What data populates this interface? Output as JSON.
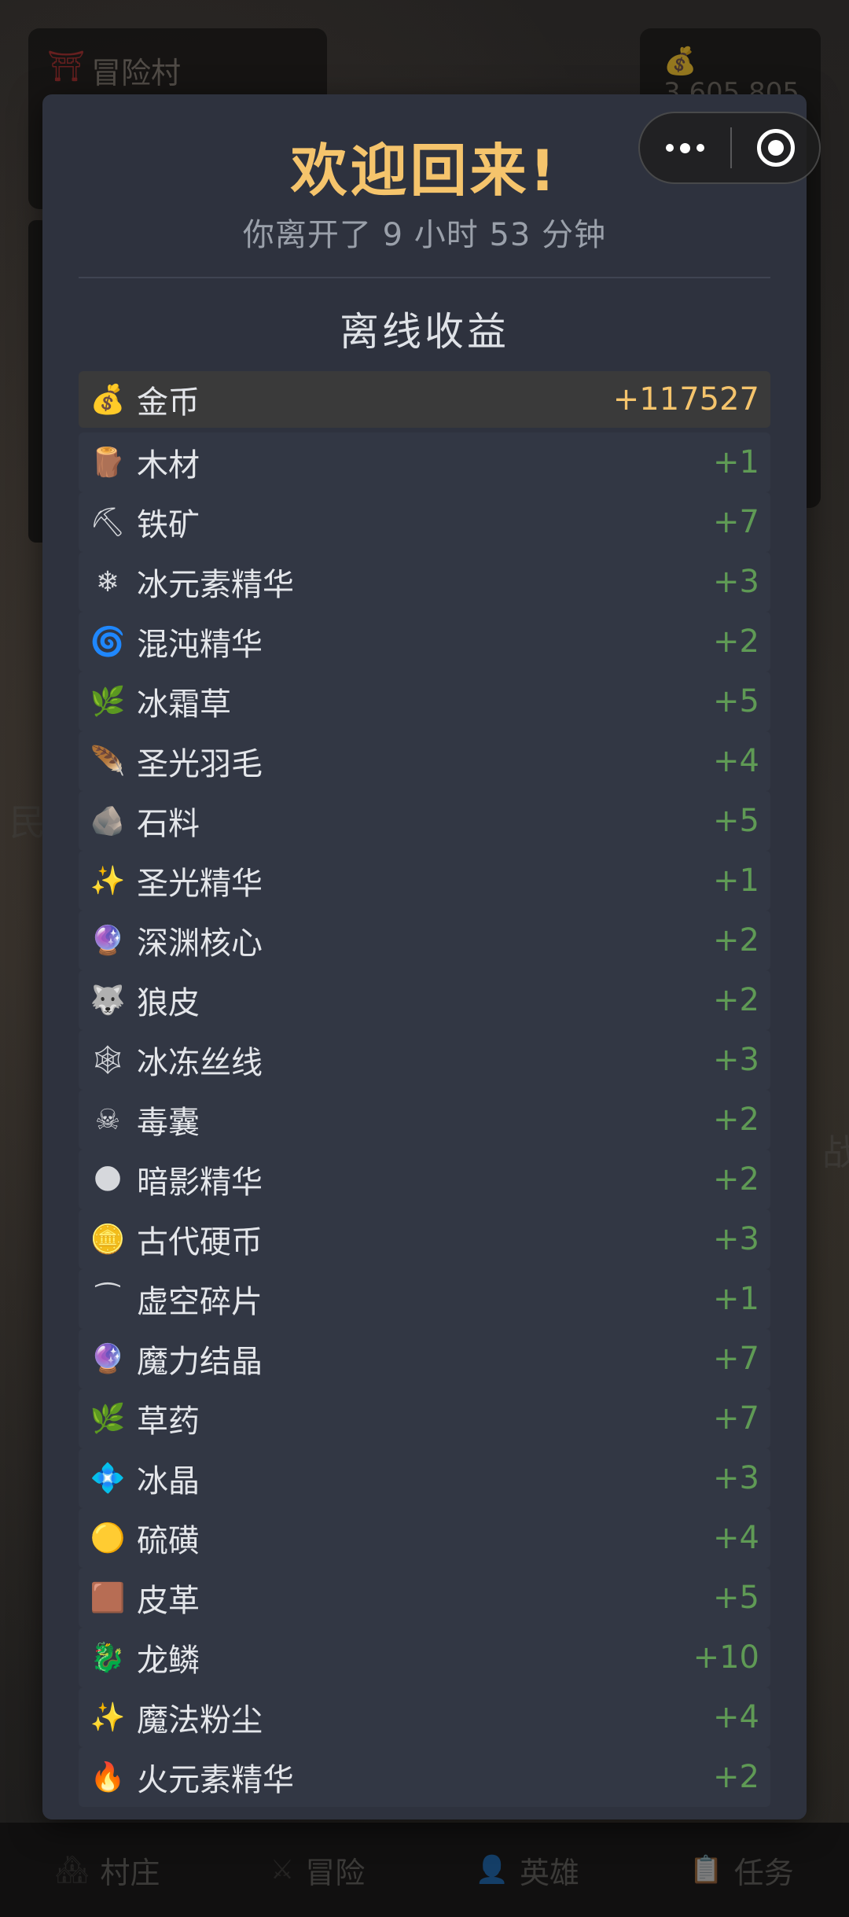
{
  "background": {
    "village_label": "冒险村",
    "gold_value": "3,605,805",
    "side_text_left": "民",
    "side_text_right": "战",
    "nav": [
      {
        "label": "村庄",
        "icon": "village-icon",
        "glyph": "🏘"
      },
      {
        "label": "冒险",
        "icon": "crossed-swords-icon",
        "glyph": "⚔"
      },
      {
        "label": "英雄",
        "icon": "hero-icon",
        "glyph": "👤"
      },
      {
        "label": "任务",
        "icon": "clipboard-icon",
        "glyph": "📋"
      }
    ]
  },
  "modal": {
    "title": "欢迎回来!",
    "subtitle": "你离开了 9 小时 53 分钟",
    "section_title": "离线收益",
    "rewards": [
      {
        "name": "金币",
        "amount": "+117527",
        "icon": "money-bag-icon",
        "glyph": "💰",
        "highlight": true
      },
      {
        "name": "木材",
        "amount": "+1",
        "icon": "wood-log-icon",
        "glyph": "🪵"
      },
      {
        "name": "铁矿",
        "amount": "+7",
        "icon": "pickaxe-icon",
        "glyph": "⛏"
      },
      {
        "name": "冰元素精华",
        "amount": "+3",
        "icon": "snowflake-icon",
        "glyph": "❄"
      },
      {
        "name": "混沌精华",
        "amount": "+2",
        "icon": "cyclone-icon",
        "glyph": "🌀"
      },
      {
        "name": "冰霜草",
        "amount": "+5",
        "icon": "herb-icon",
        "glyph": "🌿"
      },
      {
        "name": "圣光羽毛",
        "amount": "+4",
        "icon": "feather-icon",
        "glyph": "🪶"
      },
      {
        "name": "石料",
        "amount": "+5",
        "icon": "rock-icon",
        "glyph": "🪨"
      },
      {
        "name": "圣光精华",
        "amount": "+1",
        "icon": "sparkles-icon",
        "glyph": "✨"
      },
      {
        "name": "深渊核心",
        "amount": "+2",
        "icon": "crystal-ball-icon",
        "glyph": "🔮"
      },
      {
        "name": "狼皮",
        "amount": "+2",
        "icon": "wolf-icon",
        "glyph": "🐺"
      },
      {
        "name": "冰冻丝线",
        "amount": "+3",
        "icon": "spider-web-icon",
        "glyph": "🕸"
      },
      {
        "name": "毒囊",
        "amount": "+2",
        "icon": "skull-crossbones-icon",
        "glyph": "☠"
      },
      {
        "name": "暗影精华",
        "amount": "+2",
        "icon": "new-moon-icon",
        "glyph": "🌑"
      },
      {
        "name": "古代硬币",
        "amount": "+3",
        "icon": "coin-icon",
        "glyph": "🪙"
      },
      {
        "name": "虚空碎片",
        "amount": "+1",
        "icon": "void-shard-icon",
        "glyph": "⁀"
      },
      {
        "name": "魔力结晶",
        "amount": "+7",
        "icon": "crystal-ball-icon",
        "glyph": "🔮"
      },
      {
        "name": "草药",
        "amount": "+7",
        "icon": "herb-icon",
        "glyph": "🌿"
      },
      {
        "name": "冰晶",
        "amount": "+3",
        "icon": "diamond-shape-icon",
        "glyph": "💠"
      },
      {
        "name": "硫磺",
        "amount": "+4",
        "icon": "yellow-circle-icon",
        "glyph": "🟡"
      },
      {
        "name": "皮革",
        "amount": "+5",
        "icon": "brown-square-icon",
        "glyph": "🟫"
      },
      {
        "name": "龙鳞",
        "amount": "+10",
        "icon": "dragon-icon",
        "glyph": "🐉"
      },
      {
        "name": "魔法粉尘",
        "amount": "+4",
        "icon": "sparkles-icon",
        "glyph": "✨"
      },
      {
        "name": "火元素精华",
        "amount": "+2",
        "icon": "fire-icon",
        "glyph": "🔥"
      }
    ]
  },
  "colors": {
    "title": "#f5c46c",
    "gold_amount": "#f5c46c",
    "amount_green": "#5f9a55",
    "modal_bg": "#2e323e"
  }
}
